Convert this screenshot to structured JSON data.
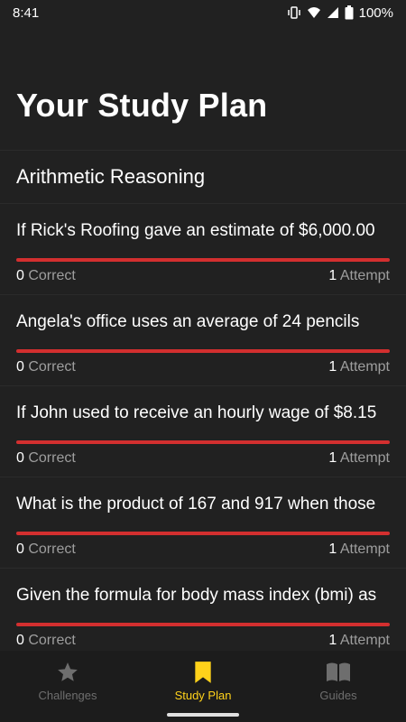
{
  "status_bar": {
    "time": "8:41",
    "battery": "100%",
    "icons": [
      "vibrate-icon",
      "wifi-icon",
      "signal-icon",
      "battery-icon"
    ]
  },
  "page": {
    "title": "Your Study Plan"
  },
  "section": {
    "title": "Arithmetic Reasoning"
  },
  "items": [
    {
      "question": "If Rick's Roofing gave an estimate of $6,000.00",
      "correct_count": "0",
      "correct_label": " Correct",
      "attempt_count": "1",
      "attempt_label": " Attempt"
    },
    {
      "question": "Angela's office uses an average of 24 pencils",
      "correct_count": "0",
      "correct_label": " Correct",
      "attempt_count": "1",
      "attempt_label": " Attempt"
    },
    {
      "question": "If John used to receive an hourly wage of $8.15",
      "correct_count": "0",
      "correct_label": " Correct",
      "attempt_count": "1",
      "attempt_label": " Attempt"
    },
    {
      "question": "What is the product of 167 and 917 when those",
      "correct_count": "0",
      "correct_label": " Correct",
      "attempt_count": "1",
      "attempt_label": " Attempt"
    },
    {
      "question": "Given the formula for body mass index (bmi) as",
      "correct_count": "0",
      "correct_label": " Correct",
      "attempt_count": "1",
      "attempt_label": " Attempt"
    }
  ],
  "bottom_nav": {
    "items": [
      {
        "label": "Challenges",
        "icon": "star-icon",
        "active": false
      },
      {
        "label": "Study Plan",
        "icon": "bookmark-icon",
        "active": true
      },
      {
        "label": "Guides",
        "icon": "book-icon",
        "active": false
      }
    ]
  },
  "colors": {
    "background": "#212121",
    "accent": "#ffd21a",
    "progress_bar": "#d32f2f",
    "muted_text": "#9e9e9e"
  }
}
